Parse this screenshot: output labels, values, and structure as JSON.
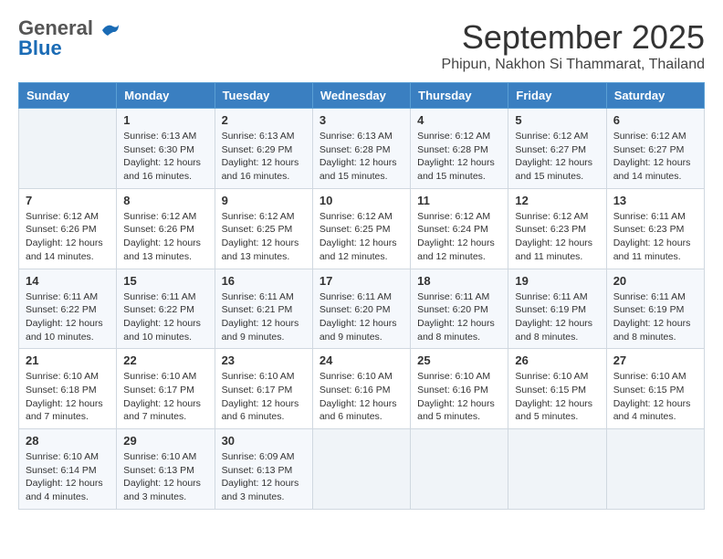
{
  "header": {
    "logo_line1": "General",
    "logo_line2": "Blue",
    "month": "September 2025",
    "location": "Phipun, Nakhon Si Thammarat, Thailand"
  },
  "days_of_week": [
    "Sunday",
    "Monday",
    "Tuesday",
    "Wednesday",
    "Thursday",
    "Friday",
    "Saturday"
  ],
  "weeks": [
    [
      {
        "day": "",
        "sunrise": "",
        "sunset": "",
        "daylight": ""
      },
      {
        "day": "1",
        "sunrise": "Sunrise: 6:13 AM",
        "sunset": "Sunset: 6:30 PM",
        "daylight": "Daylight: 12 hours and 16 minutes."
      },
      {
        "day": "2",
        "sunrise": "Sunrise: 6:13 AM",
        "sunset": "Sunset: 6:29 PM",
        "daylight": "Daylight: 12 hours and 16 minutes."
      },
      {
        "day": "3",
        "sunrise": "Sunrise: 6:13 AM",
        "sunset": "Sunset: 6:28 PM",
        "daylight": "Daylight: 12 hours and 15 minutes."
      },
      {
        "day": "4",
        "sunrise": "Sunrise: 6:12 AM",
        "sunset": "Sunset: 6:28 PM",
        "daylight": "Daylight: 12 hours and 15 minutes."
      },
      {
        "day": "5",
        "sunrise": "Sunrise: 6:12 AM",
        "sunset": "Sunset: 6:27 PM",
        "daylight": "Daylight: 12 hours and 15 minutes."
      },
      {
        "day": "6",
        "sunrise": "Sunrise: 6:12 AM",
        "sunset": "Sunset: 6:27 PM",
        "daylight": "Daylight: 12 hours and 14 minutes."
      }
    ],
    [
      {
        "day": "7",
        "sunrise": "Sunrise: 6:12 AM",
        "sunset": "Sunset: 6:26 PM",
        "daylight": "Daylight: 12 hours and 14 minutes."
      },
      {
        "day": "8",
        "sunrise": "Sunrise: 6:12 AM",
        "sunset": "Sunset: 6:26 PM",
        "daylight": "Daylight: 12 hours and 13 minutes."
      },
      {
        "day": "9",
        "sunrise": "Sunrise: 6:12 AM",
        "sunset": "Sunset: 6:25 PM",
        "daylight": "Daylight: 12 hours and 13 minutes."
      },
      {
        "day": "10",
        "sunrise": "Sunrise: 6:12 AM",
        "sunset": "Sunset: 6:25 PM",
        "daylight": "Daylight: 12 hours and 12 minutes."
      },
      {
        "day": "11",
        "sunrise": "Sunrise: 6:12 AM",
        "sunset": "Sunset: 6:24 PM",
        "daylight": "Daylight: 12 hours and 12 minutes."
      },
      {
        "day": "12",
        "sunrise": "Sunrise: 6:12 AM",
        "sunset": "Sunset: 6:23 PM",
        "daylight": "Daylight: 12 hours and 11 minutes."
      },
      {
        "day": "13",
        "sunrise": "Sunrise: 6:11 AM",
        "sunset": "Sunset: 6:23 PM",
        "daylight": "Daylight: 12 hours and 11 minutes."
      }
    ],
    [
      {
        "day": "14",
        "sunrise": "Sunrise: 6:11 AM",
        "sunset": "Sunset: 6:22 PM",
        "daylight": "Daylight: 12 hours and 10 minutes."
      },
      {
        "day": "15",
        "sunrise": "Sunrise: 6:11 AM",
        "sunset": "Sunset: 6:22 PM",
        "daylight": "Daylight: 12 hours and 10 minutes."
      },
      {
        "day": "16",
        "sunrise": "Sunrise: 6:11 AM",
        "sunset": "Sunset: 6:21 PM",
        "daylight": "Daylight: 12 hours and 9 minutes."
      },
      {
        "day": "17",
        "sunrise": "Sunrise: 6:11 AM",
        "sunset": "Sunset: 6:20 PM",
        "daylight": "Daylight: 12 hours and 9 minutes."
      },
      {
        "day": "18",
        "sunrise": "Sunrise: 6:11 AM",
        "sunset": "Sunset: 6:20 PM",
        "daylight": "Daylight: 12 hours and 8 minutes."
      },
      {
        "day": "19",
        "sunrise": "Sunrise: 6:11 AM",
        "sunset": "Sunset: 6:19 PM",
        "daylight": "Daylight: 12 hours and 8 minutes."
      },
      {
        "day": "20",
        "sunrise": "Sunrise: 6:11 AM",
        "sunset": "Sunset: 6:19 PM",
        "daylight": "Daylight: 12 hours and 8 minutes."
      }
    ],
    [
      {
        "day": "21",
        "sunrise": "Sunrise: 6:10 AM",
        "sunset": "Sunset: 6:18 PM",
        "daylight": "Daylight: 12 hours and 7 minutes."
      },
      {
        "day": "22",
        "sunrise": "Sunrise: 6:10 AM",
        "sunset": "Sunset: 6:17 PM",
        "daylight": "Daylight: 12 hours and 7 minutes."
      },
      {
        "day": "23",
        "sunrise": "Sunrise: 6:10 AM",
        "sunset": "Sunset: 6:17 PM",
        "daylight": "Daylight: 12 hours and 6 minutes."
      },
      {
        "day": "24",
        "sunrise": "Sunrise: 6:10 AM",
        "sunset": "Sunset: 6:16 PM",
        "daylight": "Daylight: 12 hours and 6 minutes."
      },
      {
        "day": "25",
        "sunrise": "Sunrise: 6:10 AM",
        "sunset": "Sunset: 6:16 PM",
        "daylight": "Daylight: 12 hours and 5 minutes."
      },
      {
        "day": "26",
        "sunrise": "Sunrise: 6:10 AM",
        "sunset": "Sunset: 6:15 PM",
        "daylight": "Daylight: 12 hours and 5 minutes."
      },
      {
        "day": "27",
        "sunrise": "Sunrise: 6:10 AM",
        "sunset": "Sunset: 6:15 PM",
        "daylight": "Daylight: 12 hours and 4 minutes."
      }
    ],
    [
      {
        "day": "28",
        "sunrise": "Sunrise: 6:10 AM",
        "sunset": "Sunset: 6:14 PM",
        "daylight": "Daylight: 12 hours and 4 minutes."
      },
      {
        "day": "29",
        "sunrise": "Sunrise: 6:10 AM",
        "sunset": "Sunset: 6:13 PM",
        "daylight": "Daylight: 12 hours and 3 minutes."
      },
      {
        "day": "30",
        "sunrise": "Sunrise: 6:09 AM",
        "sunset": "Sunset: 6:13 PM",
        "daylight": "Daylight: 12 hours and 3 minutes."
      },
      {
        "day": "",
        "sunrise": "",
        "sunset": "",
        "daylight": ""
      },
      {
        "day": "",
        "sunrise": "",
        "sunset": "",
        "daylight": ""
      },
      {
        "day": "",
        "sunrise": "",
        "sunset": "",
        "daylight": ""
      },
      {
        "day": "",
        "sunrise": "",
        "sunset": "",
        "daylight": ""
      }
    ]
  ]
}
